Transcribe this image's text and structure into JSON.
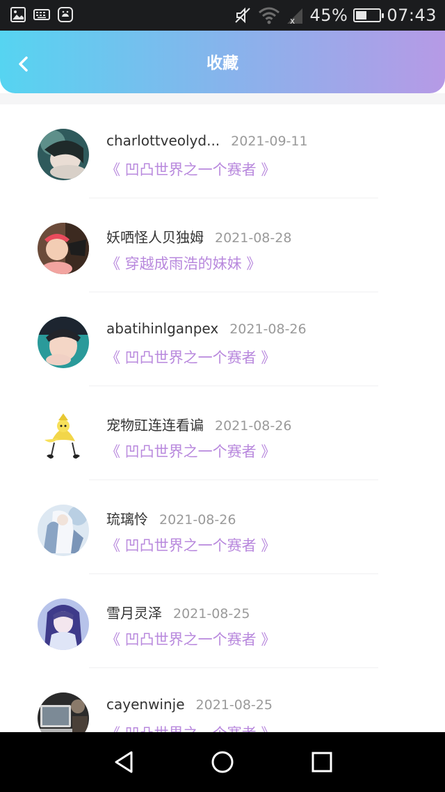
{
  "status_bar": {
    "battery_percent": "45%",
    "battery_level": 0.45,
    "time": "07:43",
    "icons": [
      "gallery-icon",
      "keyboard-icon",
      "app-icon",
      "mute-icon",
      "wifi-icon",
      "signal-icon"
    ]
  },
  "header": {
    "title": "收藏",
    "back_icon": "chevron-left-icon",
    "gradient": [
      "#56d4f1",
      "#b69ae6"
    ]
  },
  "colors": {
    "accent": "#b888dd",
    "date": "#9a9a9a",
    "username": "#333333"
  },
  "items": [
    {
      "username": "charlottveolyd...",
      "date": "2021-09-11",
      "work": "《 凹凸世界之一个赛者 》"
    },
    {
      "username": "妖哂怪人贝独姆",
      "date": "2021-08-28",
      "work": "《 穿越成雨浩的妹妹 》"
    },
    {
      "username": "abatihinlganpex",
      "date": "2021-08-26",
      "work": "《 凹凸世界之一个赛者 》"
    },
    {
      "username": "宠物豇连连看谝",
      "date": "2021-08-26",
      "work": "《 凹凸世界之一个赛者 》"
    },
    {
      "username": "琉璃怜",
      "date": "2021-08-26",
      "work": "《 凹凸世界之一个赛者 》"
    },
    {
      "username": "雪月灵泽",
      "date": "2021-08-25",
      "work": "《 凹凸世界之一个赛者 》"
    },
    {
      "username": "cayenwinje",
      "date": "2021-08-25",
      "work": "《 凹凸世界之一个赛者 》"
    }
  ],
  "nav_bar": {
    "icons": [
      "back-triangle-icon",
      "home-circle-icon",
      "recents-square-icon"
    ]
  }
}
